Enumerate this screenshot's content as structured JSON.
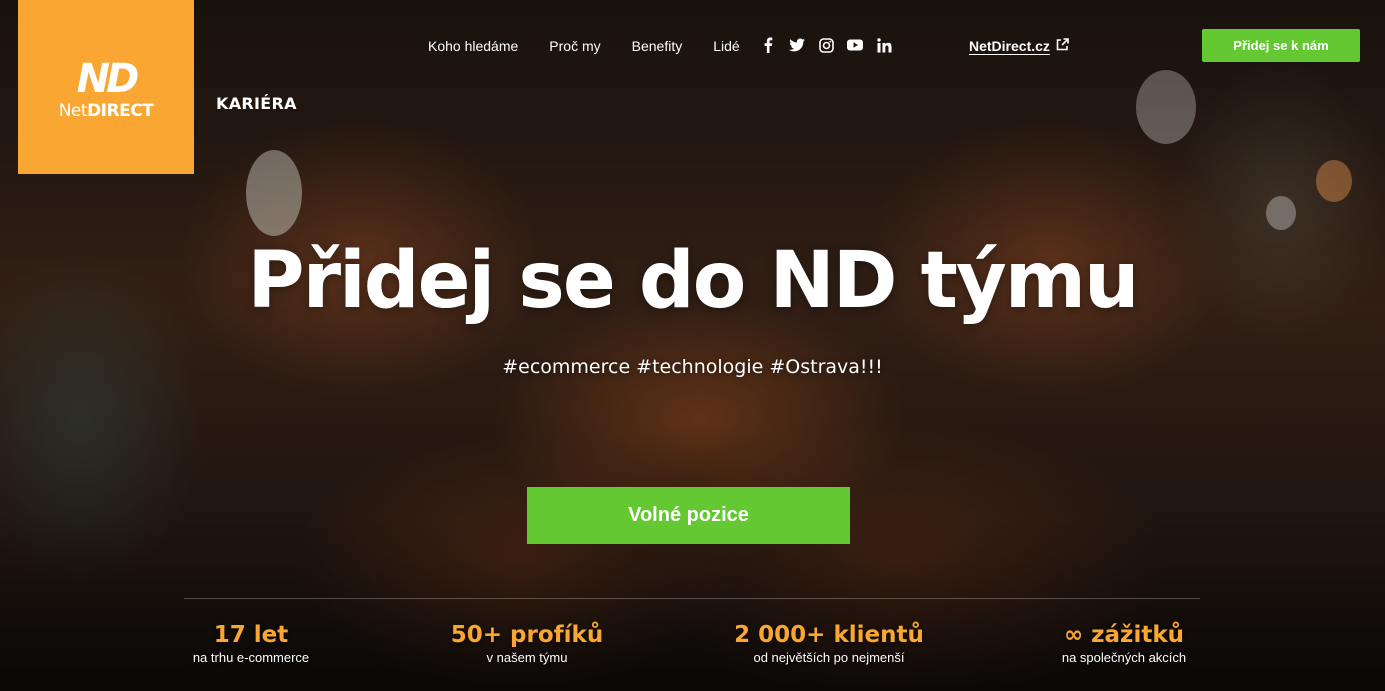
{
  "brand": {
    "logo_mark": "ND",
    "logo_text_light": "Net",
    "logo_text_bold": "DIRECT",
    "section": "KARIÉRA"
  },
  "nav": {
    "items": [
      {
        "label": "Koho hledáme"
      },
      {
        "label": "Proč my"
      },
      {
        "label": "Benefity"
      },
      {
        "label": "Lidé"
      }
    ],
    "socials": [
      "facebook-icon",
      "twitter-icon",
      "instagram-icon",
      "youtube-icon",
      "linkedin-icon"
    ],
    "external_link": "NetDirect.cz",
    "join_button": "Přidej se k nám"
  },
  "hero": {
    "title": "Přidej se do ND týmu",
    "subtitle": "#ecommerce #technologie #Ostrava!!!",
    "cta": "Volné pozice"
  },
  "stats": [
    {
      "value": "17 let",
      "label": "na trhu e-commerce"
    },
    {
      "value": "50+ profíků",
      "label": "v našem týmu"
    },
    {
      "value": "2 000+ klientů",
      "label": "od největších po nejmenší"
    },
    {
      "value": "∞ zážitků",
      "label": "na společných akcích"
    }
  ],
  "colors": {
    "brand_orange": "#f9a732",
    "accent_green": "#64c833",
    "text": "#ffffff"
  }
}
